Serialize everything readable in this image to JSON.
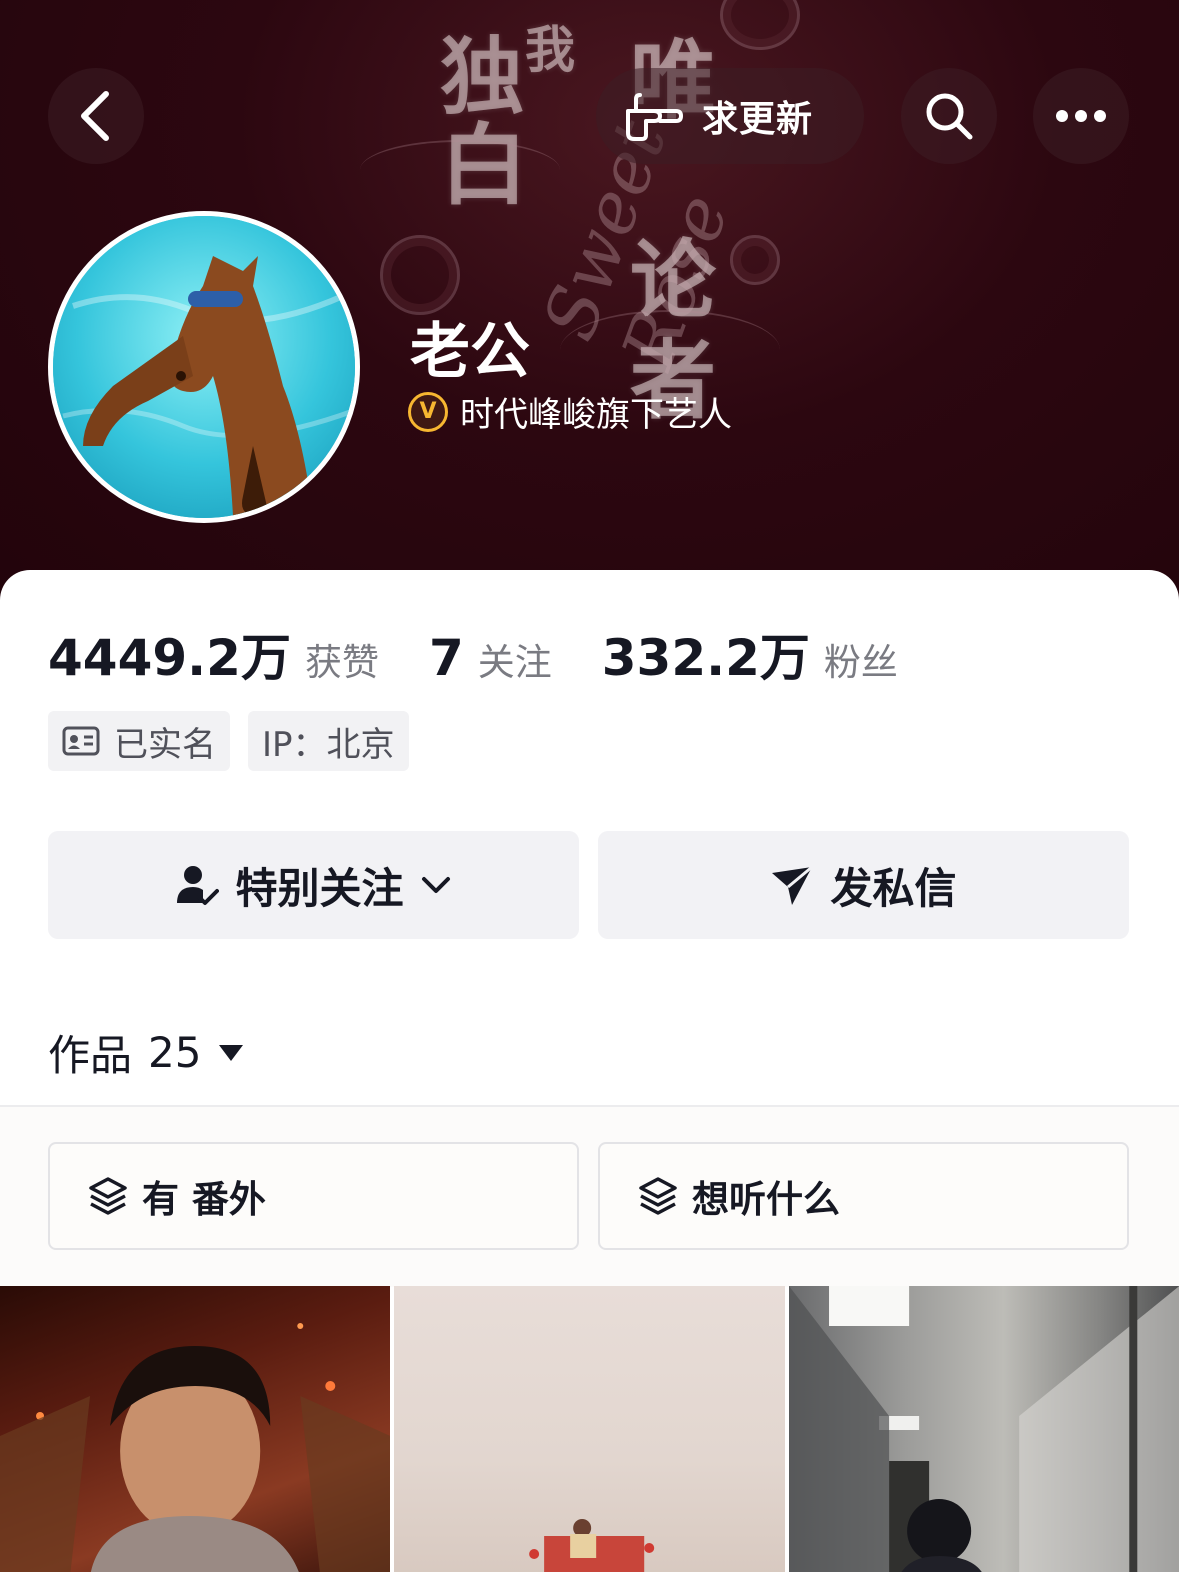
{
  "header": {
    "request_update_label": "求更新",
    "banner_art_text": [
      "独",
      "白",
      "唯",
      "我",
      "论",
      "者"
    ],
    "banner_script": "Sweet Rose"
  },
  "profile": {
    "nickname": "老公",
    "verify_badge": "V",
    "verify_text": "时代峰峻旗下艺人"
  },
  "stats": [
    {
      "value": "4449.2万",
      "label": "获赞"
    },
    {
      "value": "7",
      "label": "关注"
    },
    {
      "value": "332.2万",
      "label": "粉丝"
    }
  ],
  "tags": {
    "realname": "已实名",
    "ip": "IP：北京"
  },
  "actions": {
    "follow_label": "特别关注",
    "message_label": "发私信"
  },
  "works": {
    "label": "作品",
    "count": "25"
  },
  "collections": [
    {
      "label": "有 番外"
    },
    {
      "label": "想听什么"
    }
  ],
  "colors": {
    "banner": "#2c0710",
    "verify": "#f7b731",
    "button_bg": "#f2f2f5"
  }
}
